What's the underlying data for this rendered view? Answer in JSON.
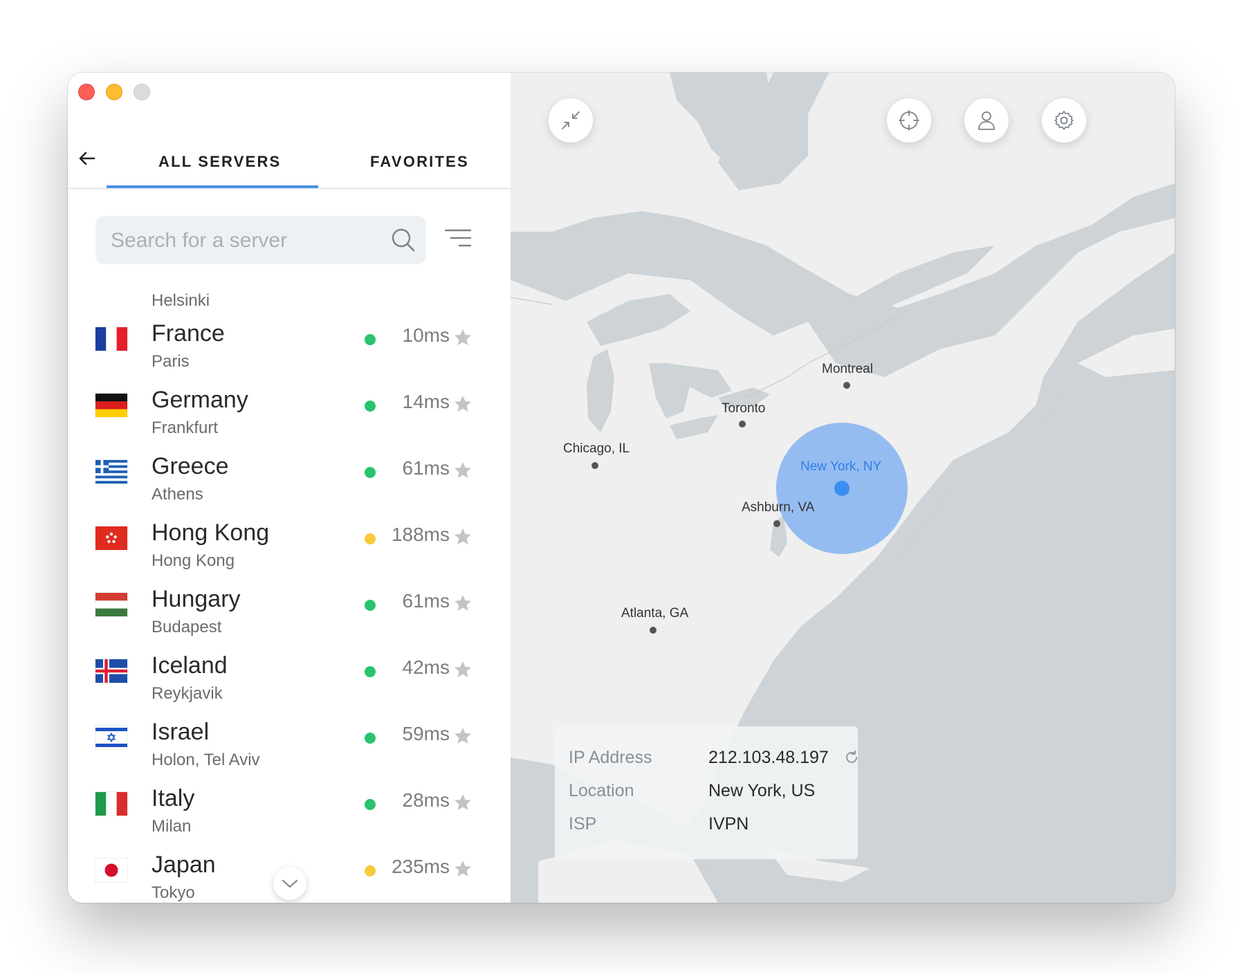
{
  "tabs": {
    "all_servers": "ALL SERVERS",
    "favorites": "FAVORITES",
    "active": "all_servers"
  },
  "search": {
    "placeholder": "Search for a server",
    "value": ""
  },
  "list": {
    "partial_top_city": "Helsinki",
    "servers": [
      {
        "country": "France",
        "city": "Paris",
        "ping": "10ms",
        "status": "good",
        "flag": "fr"
      },
      {
        "country": "Germany",
        "city": "Frankfurt",
        "ping": "14ms",
        "status": "good",
        "flag": "de"
      },
      {
        "country": "Greece",
        "city": "Athens",
        "ping": "61ms",
        "status": "good",
        "flag": "gr"
      },
      {
        "country": "Hong Kong",
        "city": "Hong Kong",
        "ping": "188ms",
        "status": "medium",
        "flag": "hk"
      },
      {
        "country": "Hungary",
        "city": "Budapest",
        "ping": "61ms",
        "status": "good",
        "flag": "hu"
      },
      {
        "country": "Iceland",
        "city": "Reykjavik",
        "ping": "42ms",
        "status": "good",
        "flag": "is"
      },
      {
        "country": "Israel",
        "city": "Holon, Tel Aviv",
        "ping": "59ms",
        "status": "good",
        "flag": "il"
      },
      {
        "country": "Italy",
        "city": "Milan",
        "ping": "28ms",
        "status": "good",
        "flag": "it"
      },
      {
        "country": "Japan",
        "city": "Tokyo",
        "ping": "235ms",
        "status": "medium",
        "flag": "jp"
      }
    ]
  },
  "status_colors": {
    "good": "#27c46b",
    "medium": "#f8c93a"
  },
  "accent_color": "#4a90e2",
  "map": {
    "cities": {
      "montreal": "Montreal",
      "toronto": "Toronto",
      "chicago": "Chicago, IL",
      "new_york": "New York, NY",
      "ashburn": "Ashburn, VA",
      "atlanta": "Atlanta, GA"
    },
    "connected_city": "New York, NY"
  },
  "info": {
    "ip_label": "IP Address",
    "ip_value": "212.103.48.197",
    "location_label": "Location",
    "location_value": "New York, US",
    "isp_label": "ISP",
    "isp_value": "IVPN"
  },
  "icons": {
    "back": "arrow-left-icon",
    "search": "search-icon",
    "filter": "filter-icon",
    "star": "star-icon",
    "expand": "chevron-down-icon",
    "minimize": "minimize-arrows-icon",
    "locate": "crosshair-icon",
    "account": "user-icon",
    "settings": "gear-icon",
    "refresh": "refresh-icon"
  }
}
